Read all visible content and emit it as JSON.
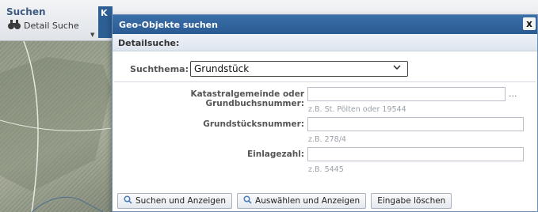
{
  "background": {
    "suchen_label": "Suchen",
    "detail_search_label": "Detail Suche",
    "tab_letter": "K"
  },
  "dialog": {
    "title": "Geo-Objekte suchen",
    "close_glyph": "x",
    "section_title": "Detailsuche:",
    "topic": {
      "label": "Suchthema:",
      "value": "Grundstück"
    },
    "fields": [
      {
        "label": "Katastralgemeinde oder Grundbuchsnummer:",
        "value": "",
        "hint": "z.B. St. Pölten oder 19544",
        "dots": "..."
      },
      {
        "label": "Grundstücksnummer:",
        "value": "",
        "hint": "z.B. 278/4"
      },
      {
        "label": "Einlagezahl:",
        "value": "",
        "hint": "z.B. 5445"
      }
    ],
    "buttons": {
      "search_show": "Suchen und Anzeigen",
      "select_show": "Auswählen und Anzeigen",
      "clear": "Eingabe löschen"
    }
  }
}
